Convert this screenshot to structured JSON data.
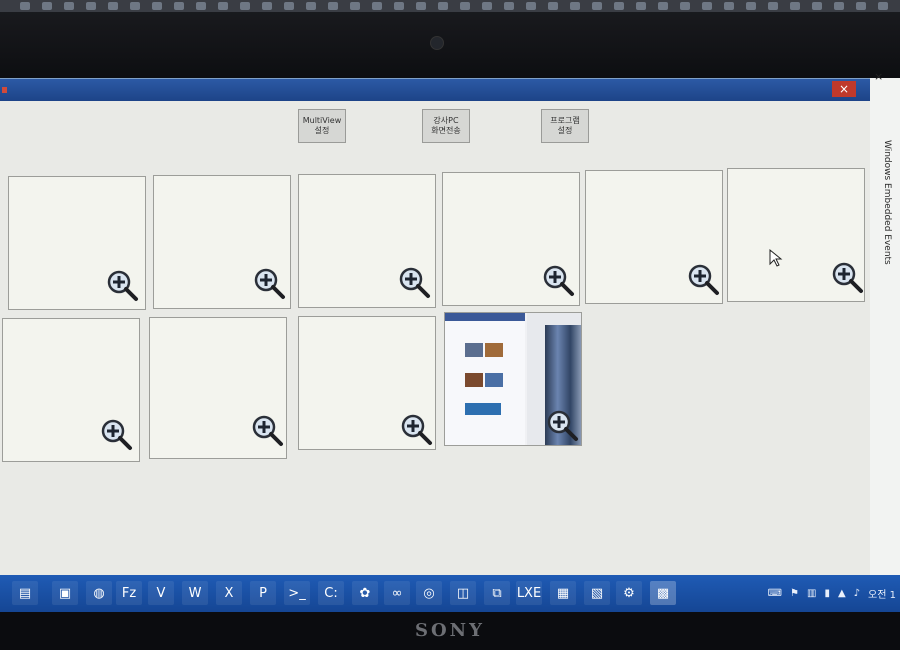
{
  "window": {
    "title": "",
    "close_label": "×",
    "buttons": [
      {
        "label": "MultiView\n설정"
      },
      {
        "label": "강사PC\n화면전송"
      },
      {
        "label": "프로그램\n설정"
      }
    ],
    "tiles_count": 10,
    "active_tile_index": 9
  },
  "side_panel": {
    "label": "Windows Embedded Events",
    "close_label": "×"
  },
  "taskbar": {
    "clock": "오전 1",
    "items": [
      {
        "icon": "folder-icon",
        "glyph": "▤"
      },
      {
        "icon": "monitor-icon",
        "glyph": "▣"
      },
      {
        "icon": "chrome-icon",
        "glyph": "◍"
      },
      {
        "icon": "filezilla-icon",
        "glyph": "Fz"
      },
      {
        "icon": "visio-icon",
        "glyph": "V"
      },
      {
        "icon": "word-icon",
        "glyph": "W"
      },
      {
        "icon": "excel-icon",
        "glyph": "X"
      },
      {
        "icon": "powerpoint-icon",
        "glyph": "P"
      },
      {
        "icon": "terminal-icon",
        "glyph": ">_"
      },
      {
        "icon": "console-icon",
        "glyph": "C:"
      },
      {
        "icon": "paint-icon",
        "glyph": "✿"
      },
      {
        "icon": "visual-studio-icon",
        "glyph": "∞"
      },
      {
        "icon": "remote-desktop-icon",
        "glyph": "◎"
      },
      {
        "icon": "viewer-icon",
        "glyph": "◫"
      },
      {
        "icon": "network-icon",
        "glyph": "⧉"
      },
      {
        "icon": "app-icon",
        "glyph": "LXE"
      },
      {
        "icon": "sticky-icon",
        "glyph": "▦"
      },
      {
        "icon": "explorer-icon",
        "glyph": "▧"
      },
      {
        "icon": "settings-icon",
        "glyph": "⚙"
      },
      {
        "icon": "multiview-icon",
        "glyph": "▩"
      }
    ]
  },
  "colors": {
    "taskbar": "#1a55a8",
    "titlebar": "#2456a0",
    "tile_bg": "#f3f4ee"
  }
}
